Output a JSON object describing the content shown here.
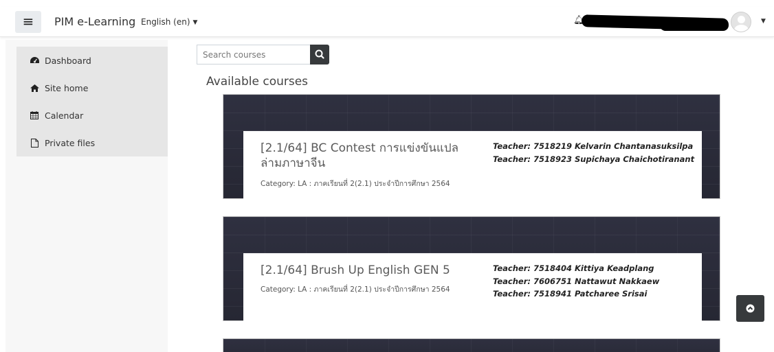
{
  "navbar": {
    "site_name": "PIM e-Learning",
    "language": "English (en)"
  },
  "drawer": {
    "items": [
      {
        "label": "Dashboard",
        "icon": "tachometer-icon"
      },
      {
        "label": "Site home",
        "icon": "home-icon"
      },
      {
        "label": "Calendar",
        "icon": "calendar-icon"
      },
      {
        "label": "Private files",
        "icon": "file-icon"
      }
    ]
  },
  "search": {
    "placeholder": "Search courses"
  },
  "main": {
    "section_title": "Available courses",
    "courses": [
      {
        "name_line1": "[2.1/64] BC Contest การแข่งขันแปล",
        "name_line2": "ล่ามภาษาจีน",
        "category": "Category: LA : ภาคเรียนที่ 2(2.1) ประจำปีการศึกษา 2564",
        "teachers": [
          "Teacher: 7518219 Kelvarin Chantanasuksilpa",
          "Teacher: 7518923 Supichaya Chaichotiranant"
        ]
      },
      {
        "name_line1": "[2.1/64] Brush Up English GEN 5",
        "category": "Category: LA : ภาคเรียนที่ 2(2.1) ประจำปีการศึกษา 2564",
        "teachers": [
          "Teacher: 7518404 Kittiya Keadplang",
          "Teacher: 7606751 Nattawut Nakkaew",
          "Teacher: 7518941 Patcharee Srisai"
        ]
      }
    ]
  }
}
